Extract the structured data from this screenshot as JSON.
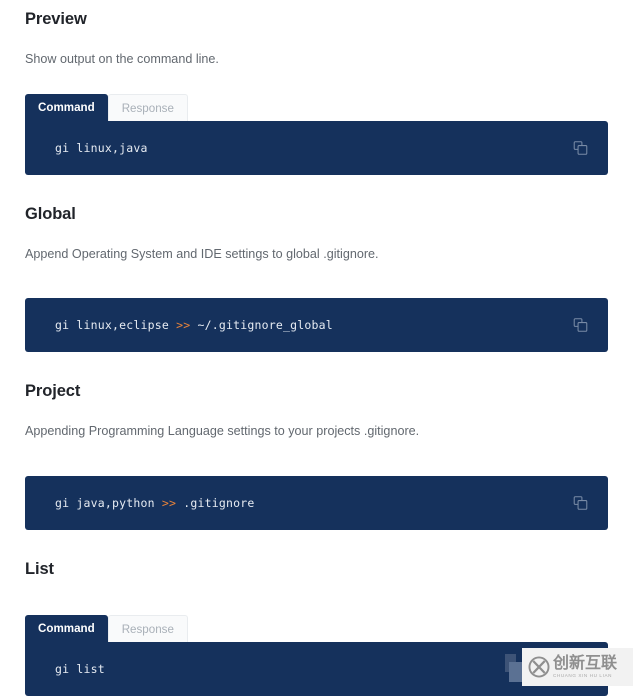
{
  "sections": [
    {
      "heading": "Preview",
      "description": "Show output on the command line.",
      "has_tabs": true,
      "tabs": [
        {
          "label": "Command",
          "active": true
        },
        {
          "label": "Response",
          "active": false
        }
      ],
      "command": {
        "prefix": "gi linux,java",
        "operator": "",
        "suffix": ""
      },
      "copy_icon": "copy-icon"
    },
    {
      "heading": "Global",
      "description": "Append Operating System and IDE settings to global .gitignore.",
      "has_tabs": false,
      "tabs": [],
      "command": {
        "prefix": "gi linux,eclipse ",
        "operator": ">>",
        "suffix": " ~/.gitignore_global"
      },
      "copy_icon": "copy-icon"
    },
    {
      "heading": "Project",
      "description": "Appending Programming Language settings to your projects .gitignore.",
      "has_tabs": false,
      "tabs": [],
      "command": {
        "prefix": "gi java,python ",
        "operator": ">>",
        "suffix": " .gitignore"
      },
      "copy_icon": "copy-icon"
    },
    {
      "heading": "List",
      "description": "",
      "has_tabs": true,
      "tabs": [
        {
          "label": "Command",
          "active": true
        },
        {
          "label": "Response",
          "active": false
        }
      ],
      "command": {
        "prefix": "gi list",
        "operator": "",
        "suffix": ""
      },
      "copy_icon": "copy-icon"
    }
  ],
  "watermark": {
    "logo": "circle-x-logo",
    "chinese_text": "创新互联",
    "pinyin_text": "CHUANG XIN HU LIAN"
  },
  "colors": {
    "code_background": "#15315c",
    "code_text": "#e6ebf2",
    "operator": "#e8833a",
    "heading": "#21242a",
    "description": "#62686f",
    "tab_inactive_text": "#a9b0b8",
    "tab_inactive_background": "#f9fafb"
  }
}
